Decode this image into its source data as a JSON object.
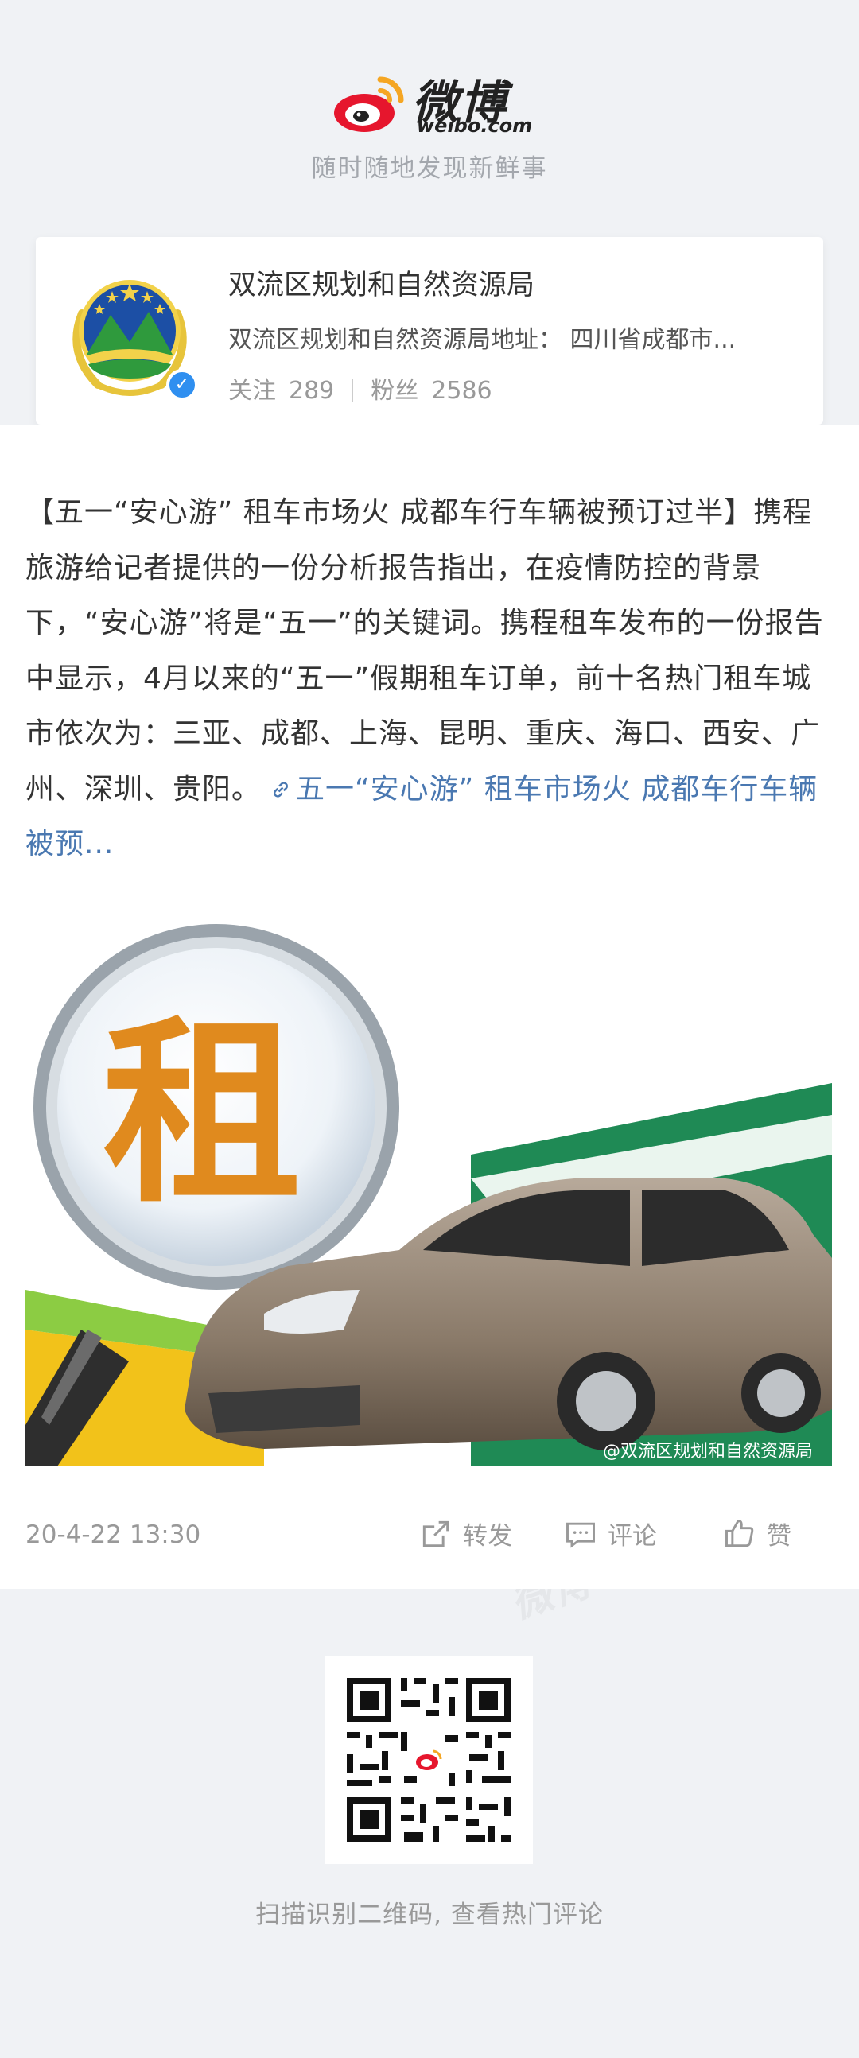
{
  "header": {
    "brand_cn": "微博",
    "brand_en": "weibo.com",
    "slogan": "随时随地发现新鲜事"
  },
  "account": {
    "name": "双流区规划和自然资源局",
    "description": "双流区规划和自然资源局地址： 四川省成都市...",
    "following_label": "关注",
    "following_count": "289",
    "followers_label": "粉丝",
    "followers_count": "2586",
    "verified": true,
    "verified_color": "#2f8ff0"
  },
  "post": {
    "text": "【五一“安心游” 租车市场火 成都车行车辆被预订过半】携程旅游给记者提供的一份分析报告指出，在疫情防控的背景下，“安心游”将是“五一”的关键词。携程租车发布的一份报告中显示，4月以来的“五一”假期租车订单，前十名热门租车城市依次为：三亚、成都、上海、昆明、重庆、海口、西安、广州、深圳、贵阳。",
    "link_text": "五一“安心游” 租车市场火 成都车行车辆被预...",
    "link_color": "#4a78b1",
    "image": {
      "main_character": "租",
      "watermark": "@双流区规划和自然资源局"
    },
    "time": "20-4-22 13:30",
    "actions": {
      "repost": "转发",
      "comment": "评论",
      "like": "赞"
    }
  },
  "footer": {
    "qr_caption": "扫描识别二维码, 查看热门评论"
  }
}
